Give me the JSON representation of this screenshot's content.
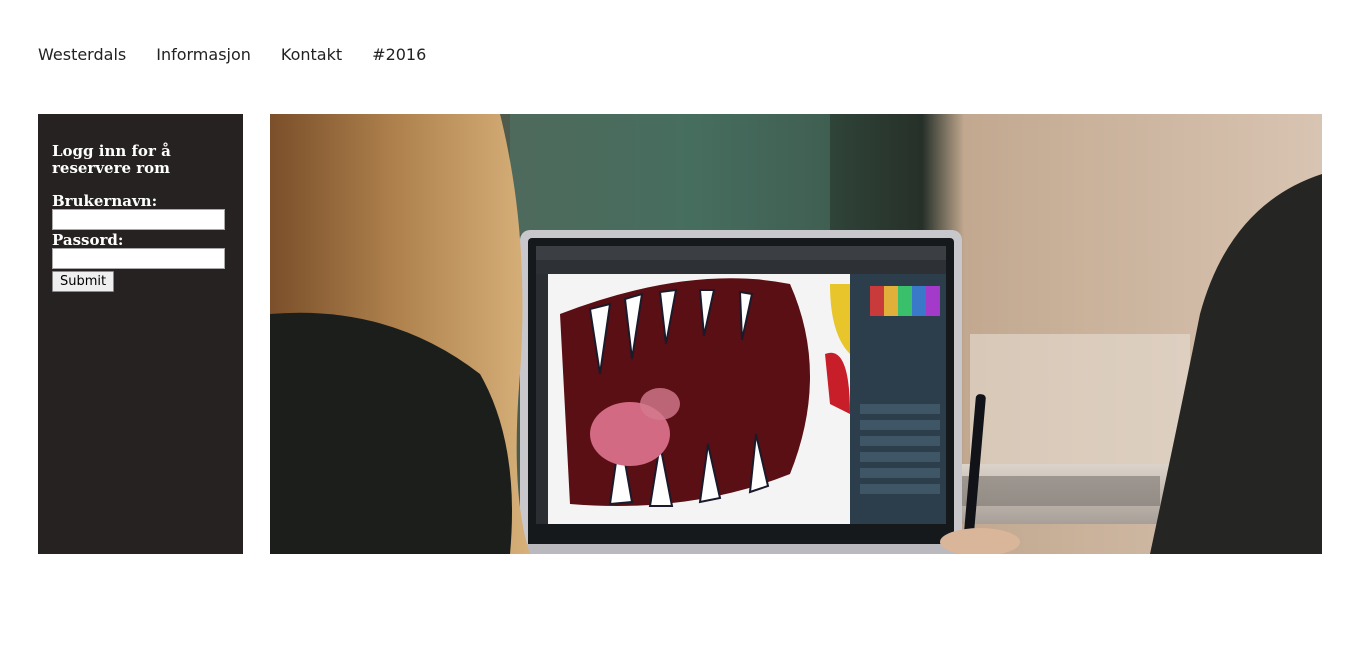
{
  "nav": {
    "items": [
      {
        "label": "Westerdals"
      },
      {
        "label": "Informasjon"
      },
      {
        "label": "Kontakt"
      },
      {
        "label": "#2016"
      }
    ]
  },
  "login": {
    "title": "Logg inn for å reservere rom",
    "username_label": "Brukernavn:",
    "username_value": "",
    "password_label": "Passord:",
    "password_value": "",
    "submit_label": "Submit"
  },
  "hero": {
    "colors": {
      "panel": "#272222",
      "background_left": "#5e5147",
      "background_right": "#c9b4a0",
      "window_green": "#2f5a4a"
    }
  }
}
